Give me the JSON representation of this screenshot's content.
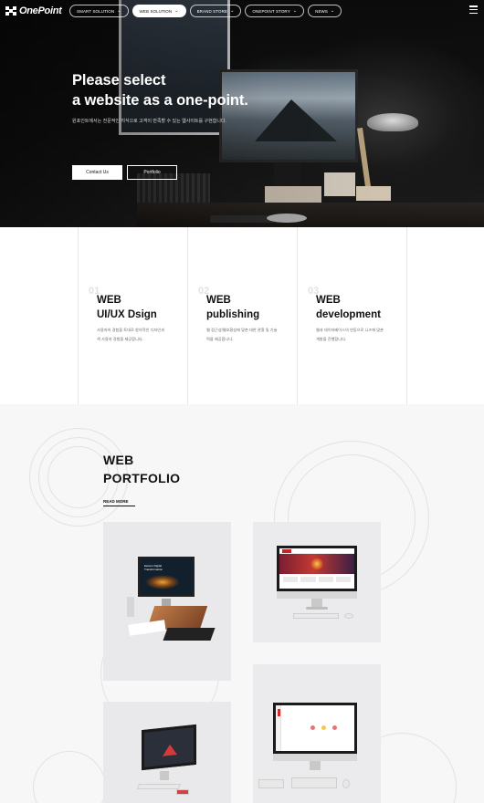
{
  "brand": {
    "name": "OnePoint"
  },
  "nav": {
    "items": [
      {
        "label": "SMART SOLUTION",
        "active": false
      },
      {
        "label": "WEB SOLUTION",
        "active": true
      },
      {
        "label": "BRAND STORE",
        "active": false
      },
      {
        "label": "ONEPOINT STORY",
        "active": false
      },
      {
        "label": "NEWS",
        "active": false
      }
    ],
    "menu_icon": "hamburger-icon"
  },
  "hero": {
    "title_line1": "Please select",
    "title_line2": "a website as a one-point.",
    "subtitle": "원포인트에서는 전문적인 지식으로 고객이 만족할 수 있는 웹사이트를 구현합니다.",
    "contact_label": "Contact Us",
    "portfolio_label": "Portfolio"
  },
  "services": [
    {
      "num": "01",
      "title_line1": "WEB",
      "title_line2": "UI/UX Dsign",
      "desc_line1": "사용자의 경험을 토대로 창의적인 디자인과",
      "desc_line2": "색 사용자 경험을 제공합니다."
    },
    {
      "num": "02",
      "title_line1": "WEB",
      "title_line2": "publishing",
      "desc_line1": "웹 접근성/웹호환성에 맞춘 대한 관찰 및 기술",
      "desc_line2": "력을 제공합니다."
    },
    {
      "num": "03",
      "title_line1": "WEB",
      "title_line2": "development",
      "desc_line1": "웹과 데이터베이스의 연동으로 니즈에 맞춘",
      "desc_line2": "개발을 진행합니다."
    }
  ],
  "portfolio": {
    "title_line1": "WEB",
    "title_line2": "PORTFOLIO",
    "more_label": "READ MORE",
    "c1_screen_title": "Ewsom Digital Transformation"
  },
  "colors": {
    "hero_bg": "#0f0f0f",
    "portfolio_bg": "#f7f7f7",
    "accent_red": "#c8232c"
  }
}
